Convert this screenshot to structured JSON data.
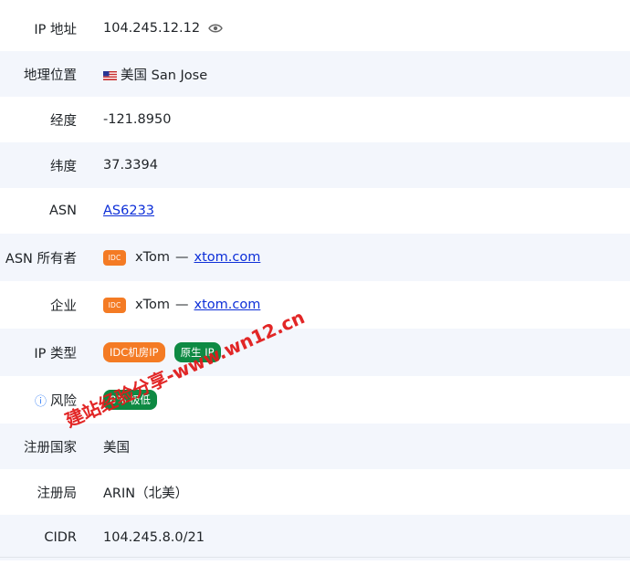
{
  "rows": [
    {
      "label": "IP 地址",
      "value": "104.245.12.12"
    },
    {
      "label": "地理位置",
      "value": "美国 San Jose"
    },
    {
      "label": "经度",
      "value": "-121.8950"
    },
    {
      "label": "纬度",
      "value": "37.3394"
    },
    {
      "label": "ASN",
      "value": "AS6233"
    },
    {
      "label": "ASN 所有者",
      "badge": "IDC",
      "name": "xTom",
      "dash": "—",
      "link": "xtom.com"
    },
    {
      "label": "企业",
      "badge": "IDC",
      "name": "xTom",
      "dash": "—",
      "link": "xtom.com"
    },
    {
      "label": "IP 类型",
      "tags": [
        "IDC机房IP",
        "原生 IP"
      ]
    },
    {
      "label": "风险",
      "info_icon": "ⓘ",
      "tag": "8% 极低"
    },
    {
      "label": "注册国家",
      "value": "美国"
    },
    {
      "label": "注册局",
      "value": "ARIN（北美）"
    },
    {
      "label": "CIDR",
      "value": "104.245.8.0/21"
    }
  ],
  "watermark": "建站经验分享-www.wn12.cn",
  "colors": {
    "orange": "#f47b24",
    "green": "#0e8a43",
    "link": "#0d2fd8",
    "stripe": "#f3f6fc"
  },
  "icons": {
    "ip_row": "eye-icon",
    "location_row": "us-flag-icon",
    "risk_row": "info-icon"
  }
}
